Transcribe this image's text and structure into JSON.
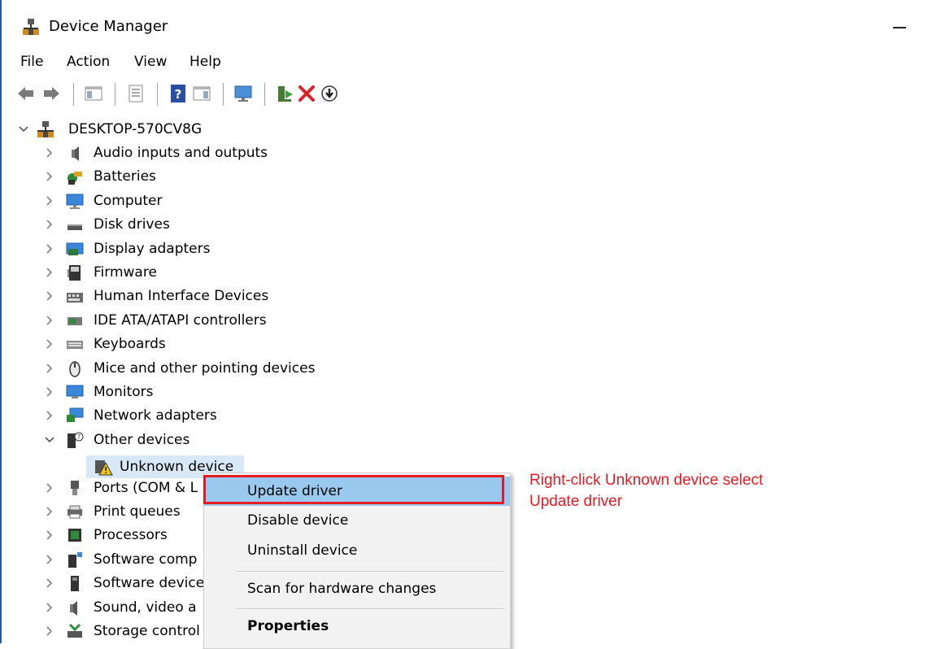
{
  "window": {
    "title": "Device Manager"
  },
  "menu": [
    "File",
    "Action",
    "View",
    "Help"
  ],
  "toolbar": {
    "buttons": [
      {
        "icon": "back-arrow-icon"
      },
      {
        "icon": "forward-arrow-icon"
      },
      {
        "icon": "show-hide-console-tree-icon"
      },
      {
        "icon": "properties-sheet-icon"
      },
      {
        "icon": "help-icon"
      },
      {
        "icon": "show-action-pane-icon"
      },
      {
        "icon": "scan-hardware-icon"
      },
      {
        "icon": "update-driver-icon"
      },
      {
        "icon": "uninstall-x-icon"
      },
      {
        "icon": "disable-download-icon"
      }
    ]
  },
  "tree": {
    "root": "DESKTOP-570CV8G",
    "categories": [
      {
        "label": "Audio inputs and outputs",
        "icon": "speaker-icon"
      },
      {
        "label": "Batteries",
        "icon": "battery-icon"
      },
      {
        "label": "Computer",
        "icon": "computer-monitor-icon"
      },
      {
        "label": "Disk drives",
        "icon": "disk-drive-icon"
      },
      {
        "label": "Display adapters",
        "icon": "display-adapter-icon"
      },
      {
        "label": "Firmware",
        "icon": "firmware-chip-icon"
      },
      {
        "label": "Human Interface Devices",
        "icon": "hid-keyboard-icon"
      },
      {
        "label": "IDE ATA/ATAPI controllers",
        "icon": "ide-controller-icon"
      },
      {
        "label": "Keyboards",
        "icon": "keyboard-icon"
      },
      {
        "label": "Mice and other pointing devices",
        "icon": "mouse-icon"
      },
      {
        "label": "Monitors",
        "icon": "monitor-icon"
      },
      {
        "label": "Network adapters",
        "icon": "network-adapter-icon"
      },
      {
        "label": "Other devices",
        "icon": "unknown-device-icon",
        "expanded": true
      },
      {
        "label": "Ports (COM & L",
        "icon": "port-icon"
      },
      {
        "label": "Print queues",
        "icon": "printer-icon"
      },
      {
        "label": "Processors",
        "icon": "processor-icon"
      },
      {
        "label": "Software comp",
        "icon": "software-component-icon"
      },
      {
        "label": "Software device",
        "icon": "software-device-icon"
      },
      {
        "label": "Sound, video a",
        "icon": "sound-icon"
      },
      {
        "label": "Storage control",
        "icon": "storage-controller-icon"
      }
    ],
    "child": {
      "label": "Unknown device",
      "icon": "warning-device-icon"
    }
  },
  "context_menu": {
    "items": [
      "Update driver",
      "Disable device",
      "Uninstall device",
      "Scan for hardware changes",
      "Properties"
    ]
  },
  "annotation": {
    "line1": "Right-click Unknown device select",
    "line2": "Update driver",
    "color": "#e41b23"
  }
}
